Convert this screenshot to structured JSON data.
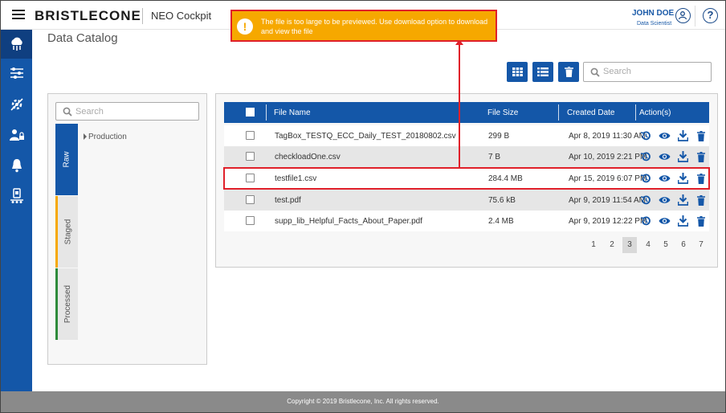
{
  "header": {
    "logo": "BRISTLECONE",
    "app_name": "NEO Cockpit",
    "user_name": "JOHN DOE",
    "user_role": "Data Scientist",
    "help_glyph": "?"
  },
  "sidebar": {
    "items": [
      {
        "icon": "cloud-data-icon",
        "active": true
      },
      {
        "icon": "sliders-icon",
        "active": false
      },
      {
        "icon": "settings-off-icon",
        "active": false
      },
      {
        "icon": "user-lock-icon",
        "active": false
      },
      {
        "icon": "bell-icon",
        "active": false
      },
      {
        "icon": "device-icon",
        "active": false
      }
    ]
  },
  "page": {
    "title": "Data Catalog"
  },
  "toolbar": {
    "search_placeholder": "Search"
  },
  "left_panel": {
    "search_placeholder": "Search",
    "tabs": [
      {
        "label": "Raw",
        "active": true,
        "color": "#1457a8"
      },
      {
        "label": "Staged",
        "active": false,
        "color": "#f6a800"
      },
      {
        "label": "Processed",
        "active": false,
        "color": "#2e8b3a"
      }
    ],
    "tree_item": "Production"
  },
  "table": {
    "headers": {
      "file_name": "File Name",
      "file_size": "File Size",
      "created_date": "Created Date",
      "actions": "Action(s)"
    },
    "rows": [
      {
        "name": "TagBox_TESTQ_ECC_Daily_TEST_20180802.csv",
        "size": "299 B",
        "date": "Apr 8, 2019 11:30 AM"
      },
      {
        "name": "checkloadOne.csv",
        "size": "7 B",
        "date": "Apr 10, 2019 2:21 PM"
      },
      {
        "name": "testfile1.csv",
        "size": "284.4 MB",
        "date": "Apr 15, 2019 6:07 PM"
      },
      {
        "name": "test.pdf",
        "size": "75.6 kB",
        "date": "Apr 9, 2019 11:54 AM"
      },
      {
        "name": "supp_lib_Helpful_Facts_About_Paper.pdf",
        "size": "2.4 MB",
        "date": "Apr 9, 2019 12:22 PM"
      }
    ]
  },
  "pagination": {
    "pages": [
      "1",
      "2",
      "3",
      "4",
      "5",
      "6",
      "7"
    ],
    "current": "3"
  },
  "toast": {
    "icon": "!",
    "message": "The file is too large to be previewed. Use download option to download and view the file"
  },
  "footer": {
    "copyright": "Copyright © 2019 Bristlecone, Inc. All rights reserved."
  },
  "colors": {
    "primary": "#1457a8",
    "warning": "#f6a800",
    "highlight": "#e0202a",
    "footer": "#8a8a8a"
  }
}
